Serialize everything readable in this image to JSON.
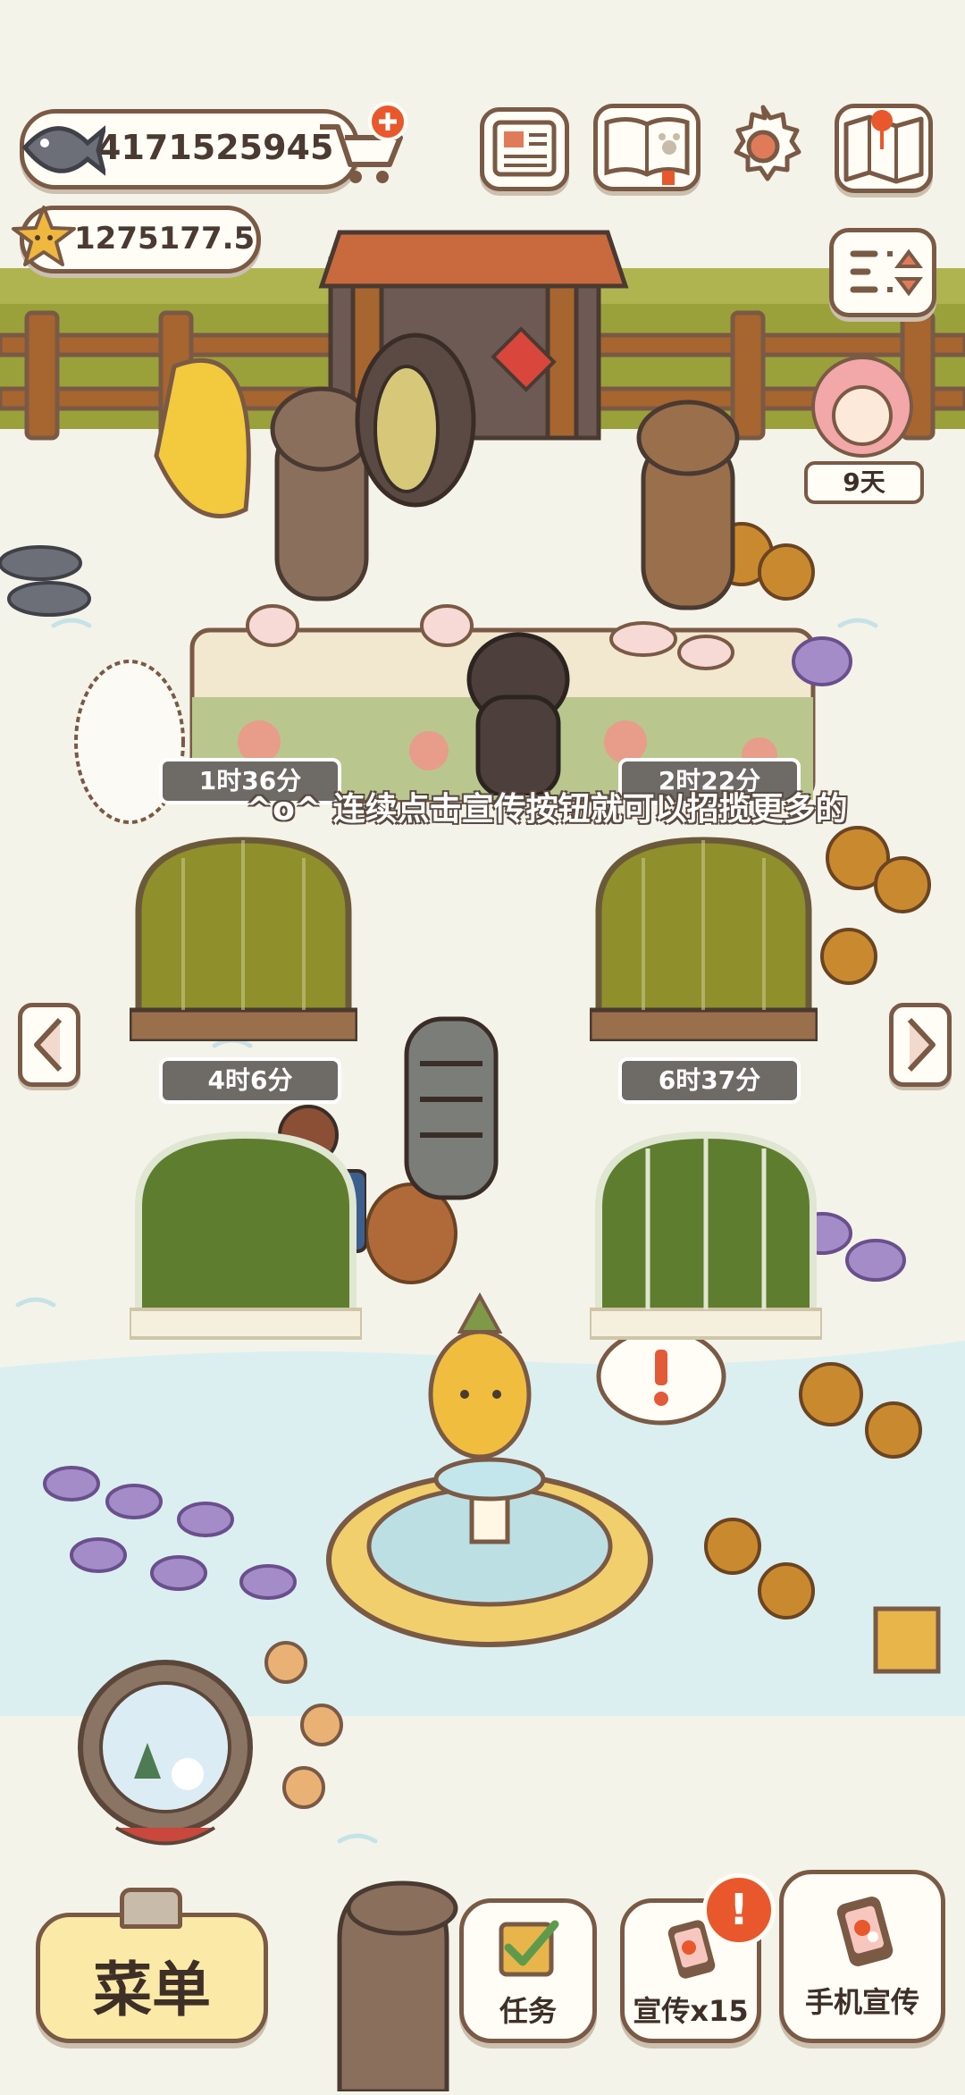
{
  "hud": {
    "fish_currency": "4171525945",
    "star_currency": "1275177.5",
    "event_days": "9天"
  },
  "icons": {
    "fish": "fish-icon",
    "cart_plus": "shopping-cart-plus-icon",
    "star": "star-icon",
    "newspaper": "newspaper-icon",
    "pawbook": "paw-book-icon",
    "settings": "gear-icon",
    "map": "map-icon",
    "sort": "sort-toggle-icon"
  },
  "timers": [
    "1时36分",
    "2时22分",
    "4时6分",
    "6时37分"
  ],
  "tip_text": "^o^ 连续点击宣传按钮就可以招揽更多的",
  "bottom": {
    "menu": "菜单",
    "task": "任务",
    "promote": "宣传x15",
    "phone_promote": "手机宣传",
    "promote_badge": "!"
  },
  "colors": {
    "outline": "#7a5a45",
    "cream": "#fffdf6",
    "menu_fill": "#fbe9a8",
    "badge": "#e8582c",
    "grass_green": "#7e8b2a",
    "water": "#dff0f2"
  }
}
